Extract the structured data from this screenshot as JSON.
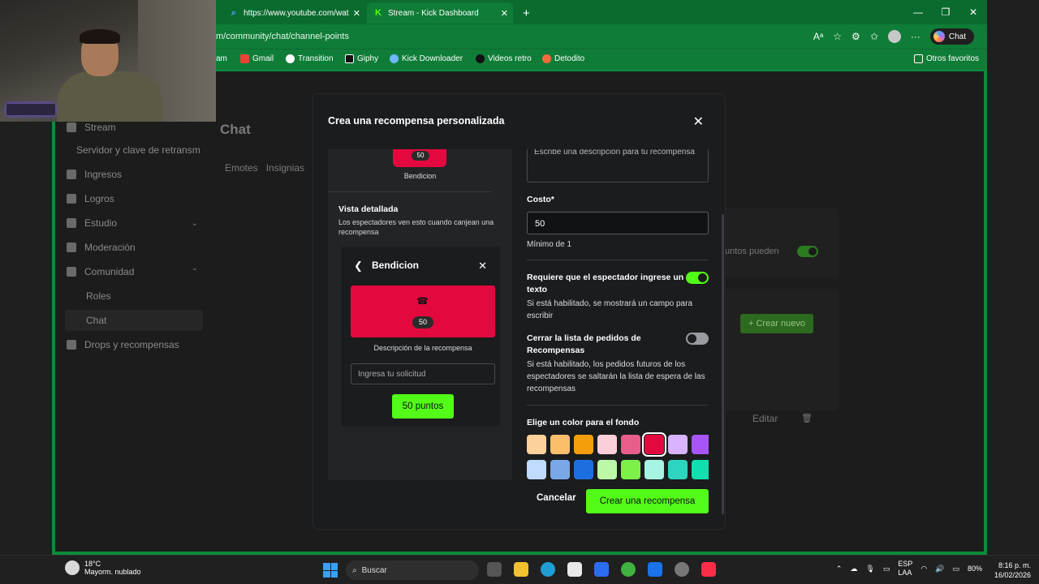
{
  "browser": {
    "tabs": [
      {
        "label": "https://www.youtube.com/wat",
        "icon": "youtube-icon"
      },
      {
        "label": "Stream - Kick Dashboard",
        "icon": "kick-icon"
      }
    ],
    "url": "m/community/chat/channel-points",
    "chat_button": "Chat",
    "bookmarks": [
      "am",
      "Gmail",
      "Transition",
      "Giphy",
      "Kick Downloader",
      "Videos retro",
      "Detodito"
    ],
    "other_favorites": "Otros favoritos"
  },
  "sidebar": {
    "items": [
      {
        "label": "Stream",
        "icon": "broadcast-icon"
      },
      {
        "label": "Servidor y clave de retransm",
        "sub": true
      },
      {
        "label": "Ingresos",
        "icon": "chart-icon"
      },
      {
        "label": "Logros",
        "icon": "trophy-icon"
      },
      {
        "label": "Estudio",
        "icon": "studio-icon"
      },
      {
        "label": "Moderación",
        "icon": "wrench-icon"
      },
      {
        "label": "Comunidad",
        "icon": "people-icon"
      },
      {
        "label": "Roles",
        "sub": true
      },
      {
        "label": "Chat",
        "sub": true,
        "selected": true
      },
      {
        "label": "Drops y recompensas",
        "icon": "gift-icon"
      }
    ]
  },
  "page": {
    "title": "Chat",
    "tabs": [
      "Emotes",
      "Insignias"
    ],
    "bg_text_points": "untos pueden",
    "bg_create_new": "Crear nuevo",
    "bg_edit": "Editar"
  },
  "modal": {
    "title": "Crea una recompensa personalizada",
    "mini_preview": {
      "cost": "50",
      "name": "Bendicion"
    },
    "detail_title": "Vista detallada",
    "detail_desc": "Los espectadores ven esto cuando canjean una recompensa",
    "preview": {
      "title": "Bendicion",
      "cost": "50",
      "description": "Descripción de la recompensa",
      "input_placeholder": "Ingresa tu solicitud",
      "button": "50 puntos"
    },
    "description_placeholder": "Escribe una descripción para tu recompensa",
    "cost_label": "Costo*",
    "cost_value": "50",
    "cost_hint": "Mínimo de 1",
    "require_text": {
      "label": "Requiere que el espectador ingrese un texto",
      "desc": "Si está habilitado, se mostrará un campo para escribir",
      "enabled": true
    },
    "close_queue": {
      "label": "Cerrar la lista de pedidos de Recompensas",
      "desc": "Si está habilitado, los pedidos futuros de los espectadores se saltarán la lista de espera de las recompensas",
      "enabled": false
    },
    "color_label": "Elige un color para el fondo",
    "colors": [
      "#fdd29a",
      "#fbbf6c",
      "#f59e0b",
      "#fbcfd9",
      "#e85d8a",
      "#e3093f",
      "#d8b4fe",
      "#a855f7",
      "#bfdbfe",
      "#7aa7e8",
      "#1d6fe0",
      "#bdf7a8",
      "#7ef04a",
      "#a7f3e4",
      "#2dd4bf",
      "#10e0b0"
    ],
    "selected_color": "#e3093f",
    "cancel": "Cancelar",
    "create": "Crear una recompensa",
    "accent": "#53fc18"
  },
  "taskbar": {
    "weather_temp": "18°C",
    "weather_desc": "Mayorm. nublado",
    "search": "Buscar",
    "lang1": "ESP",
    "lang2": "LAA",
    "battery": "80%",
    "time": "8:16 p. m.",
    "date": "16/02/2026"
  }
}
